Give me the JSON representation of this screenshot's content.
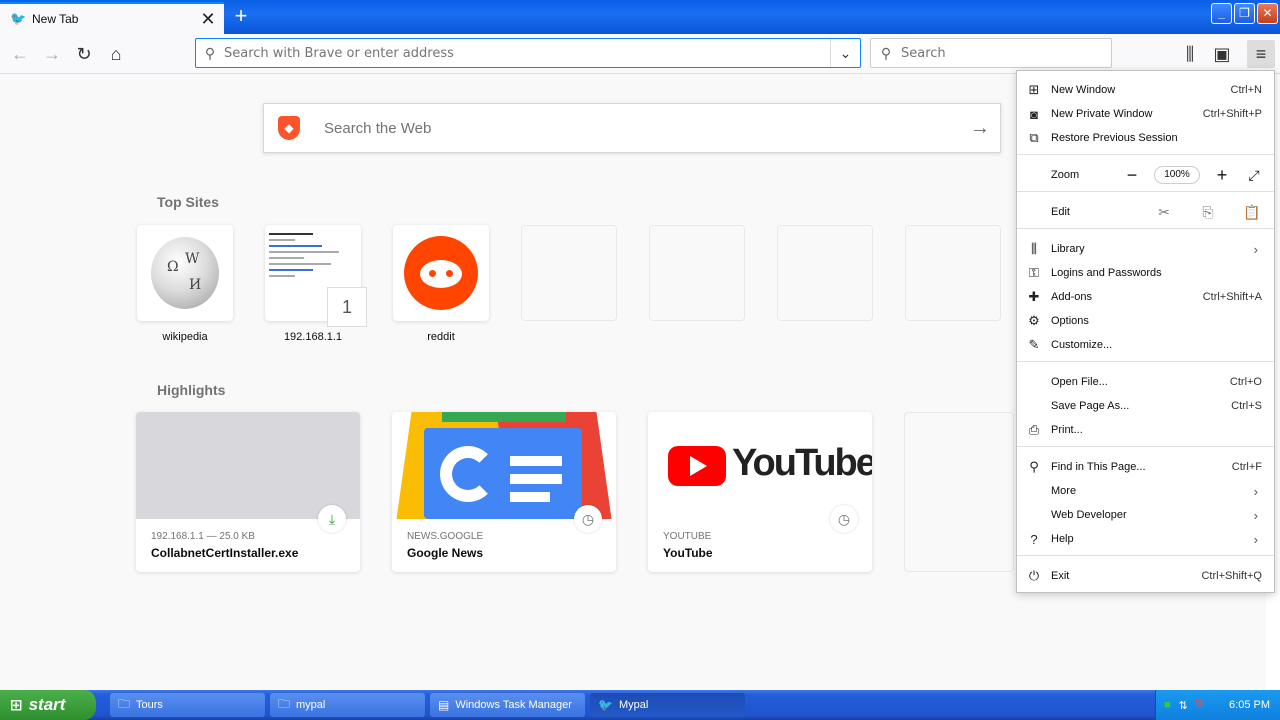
{
  "browser": {
    "tab_title": "New Tab",
    "new_tab_symbol": "+",
    "url_placeholder": "Search with Brave or enter address",
    "search_placeholder": "Search"
  },
  "newtab": {
    "web_search_placeholder": "Search the Web",
    "top_sites_title": "Top Sites",
    "top_sites": [
      {
        "label": "wikipedia"
      },
      {
        "label": "192.168.1.1",
        "badge": "1"
      },
      {
        "label": "reddit"
      }
    ],
    "highlights_title": "Highlights",
    "highlights": [
      {
        "source": "192.168.1.1 — 25.0 KB",
        "title": "CollabnetCertInstaller.exe"
      },
      {
        "source": "NEWS.GOOGLE",
        "title": "Google News"
      },
      {
        "source": "YOUTUBE",
        "title": "YouTube"
      }
    ]
  },
  "menu": {
    "items": [
      {
        "label": "New Window",
        "shortcut": "Ctrl+N",
        "icon": "new-window-icon"
      },
      {
        "label": "New Private Window",
        "shortcut": "Ctrl+Shift+P",
        "icon": "private-mask-icon"
      },
      {
        "label": "Restore Previous Session",
        "icon": "restore-session-icon"
      },
      {
        "label": "Zoom",
        "value": "100%"
      },
      {
        "label": "Edit"
      },
      {
        "label": "Library",
        "icon": "library-icon"
      },
      {
        "label": "Logins and Passwords",
        "icon": "key-icon"
      },
      {
        "label": "Add-ons",
        "shortcut": "Ctrl+Shift+A",
        "icon": "puzzle-icon"
      },
      {
        "label": "Options",
        "icon": "gear-icon"
      },
      {
        "label": "Customize...",
        "icon": "paintbrush-icon"
      },
      {
        "label": "Open File...",
        "shortcut": "Ctrl+O"
      },
      {
        "label": "Save Page As...",
        "shortcut": "Ctrl+S"
      },
      {
        "label": "Print...",
        "icon": "printer-icon"
      },
      {
        "label": "Find in This Page...",
        "shortcut": "Ctrl+F",
        "icon": "search-icon"
      },
      {
        "label": "More"
      },
      {
        "label": "Web Developer"
      },
      {
        "label": "Help",
        "icon": "help-icon"
      },
      {
        "label": "Exit",
        "shortcut": "Ctrl+Shift+Q",
        "icon": "power-icon"
      }
    ]
  },
  "taskbar": {
    "start_label": "start",
    "tasks": [
      {
        "label": "Tours"
      },
      {
        "label": "mypal"
      },
      {
        "label": "Windows Task Manager"
      },
      {
        "label": "Mypal"
      }
    ],
    "clock": "6:05 PM"
  },
  "colors": {
    "accent": "#0a84ff",
    "brave": "#fb542b",
    "reddit": "#ff4500",
    "youtube": "#ff0000"
  }
}
